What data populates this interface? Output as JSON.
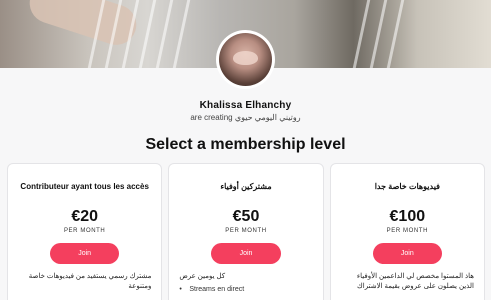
{
  "creator": {
    "name": "Khalissa Elhanchy",
    "desc": "are creating روتيني اليومي حيوي"
  },
  "page": {
    "title": "Select a membership level"
  },
  "tiers": [
    {
      "name": "Contributeur ayant tous les accès",
      "price": "€20",
      "period": "PER MONTH",
      "button": "Join",
      "desc": "مشترك رسمي يستفيد من فيديوهات خاصة ومتنوعة"
    },
    {
      "name": "مشتركين أوفياء",
      "price": "€50",
      "period": "PER MONTH",
      "button": "Join",
      "desc": "كل يومين عرض",
      "bullets": [
        "Streams en direct"
      ]
    },
    {
      "name": "فيديوهات خاصة جدا",
      "price": "€100",
      "period": "PER MONTH",
      "button": "Join",
      "desc": "هاذ المستوا مخصص لي الداعمين الأوفياء الذين يصلون على عروض بقيمة الاشتراك"
    }
  ],
  "colors": {
    "join_button": "#f43f5e",
    "background": "#f7f7f8"
  }
}
